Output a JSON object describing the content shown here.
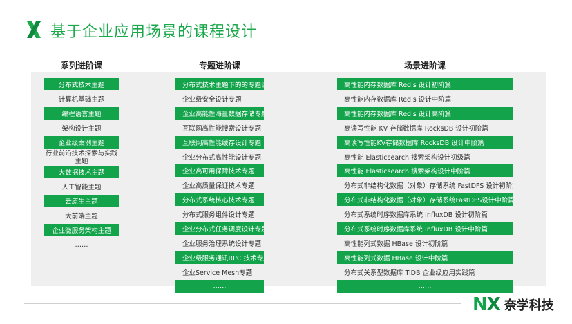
{
  "header": {
    "title": "基于企业应用场景的课程设计",
    "logo_icon": "green-x-mark-icon"
  },
  "columns": [
    {
      "header": "系列进阶课",
      "items": [
        {
          "label": "分布式技术主题",
          "highlight": true
        },
        {
          "label": "计算机基础主题",
          "highlight": false
        },
        {
          "label": "编程语言主题",
          "highlight": true
        },
        {
          "label": "架构设计主题",
          "highlight": false
        },
        {
          "label": "企业级案例主题",
          "highlight": true
        },
        {
          "label": "行业前沿技术探索与实践主题",
          "highlight": false
        },
        {
          "label": "大数据技术主题",
          "highlight": true
        },
        {
          "label": "人工智能主题",
          "highlight": false
        },
        {
          "label": "云原生主题",
          "highlight": true
        },
        {
          "label": "大前端主题",
          "highlight": false
        },
        {
          "label": "企业微服务架构主题",
          "highlight": true
        },
        {
          "label": "……",
          "highlight": false
        }
      ]
    },
    {
      "header": "专题进阶课",
      "items": [
        {
          "label": "分布式技术主题下的的专题课",
          "highlight": true
        },
        {
          "label": "企业级安全设计专题",
          "highlight": false
        },
        {
          "label": "企业高能性海量数据存储专题",
          "highlight": true
        },
        {
          "label": "互联网高性能搜索设计专题",
          "highlight": false
        },
        {
          "label": "互联网高性能缓存设计专题",
          "highlight": true
        },
        {
          "label": "企业分布式高性能设计专题",
          "highlight": false
        },
        {
          "label": "企业高可用保障技术专题",
          "highlight": true
        },
        {
          "label": "企业高质量保证技术专题",
          "highlight": false
        },
        {
          "label": "分布式系统核心技术专题",
          "highlight": true
        },
        {
          "label": "分布式服务组件设计专题",
          "highlight": false
        },
        {
          "label": "企业分布式任务调度设计专题",
          "highlight": true
        },
        {
          "label": "企业服务治理系统设计专题",
          "highlight": false
        },
        {
          "label": "企业级服务通讯RPC 技术专题",
          "highlight": true
        },
        {
          "label": "企业Service Mesh专题",
          "highlight": false
        },
        {
          "label": "……",
          "highlight": true
        }
      ]
    },
    {
      "header": "场景进阶课",
      "items": [
        {
          "label": "高性能内存数据库 Redis 设计初阶篇",
          "highlight": true
        },
        {
          "label": "高性能内存数据库 Redis 设计中阶篇",
          "highlight": false
        },
        {
          "label": "高性能内存数据库 Redis 设计高阶篇",
          "highlight": true
        },
        {
          "label": "高读写性能 KV 存储数据库 RocksDB 设计初阶篇",
          "highlight": false
        },
        {
          "label": "高读写性能KV存储数据库 RocksDB 设计中阶篇",
          "highlight": true
        },
        {
          "label": "高性能 Elasticsearch 搜索架构设计初级篇",
          "highlight": false
        },
        {
          "label": "高性能 Elasticsearch 搜索架构设计中阶篇",
          "highlight": true
        },
        {
          "label": "分布式非结构化数据（对象）存储系统 FastDFS 设计初阶篇",
          "highlight": false
        },
        {
          "label": "分布式非结构化数据（对象）存储系统FastDFS设计中阶篇",
          "highlight": true
        },
        {
          "label": "分布式系统时序数据库系统 InfluxDB 设计初阶篇",
          "highlight": false
        },
        {
          "label": "分布式系统时序数据库系统 InfluxDB 设计中阶篇",
          "highlight": true
        },
        {
          "label": "高性能列式数据 HBase 设计初阶篇",
          "highlight": false
        },
        {
          "label": "高性能列式数据 HBase 设计中阶篇",
          "highlight": true
        },
        {
          "label": "分布式关系型数据库 TiDB 企业级应用实践篇",
          "highlight": false
        },
        {
          "label": "……",
          "highlight": true
        }
      ]
    }
  ],
  "brand": {
    "mark_n": "N",
    "mark_x": "X",
    "name": "奈学科技"
  },
  "colors": {
    "accent": "#12a34b",
    "title": "#19a84a",
    "panel": "#efefef"
  }
}
